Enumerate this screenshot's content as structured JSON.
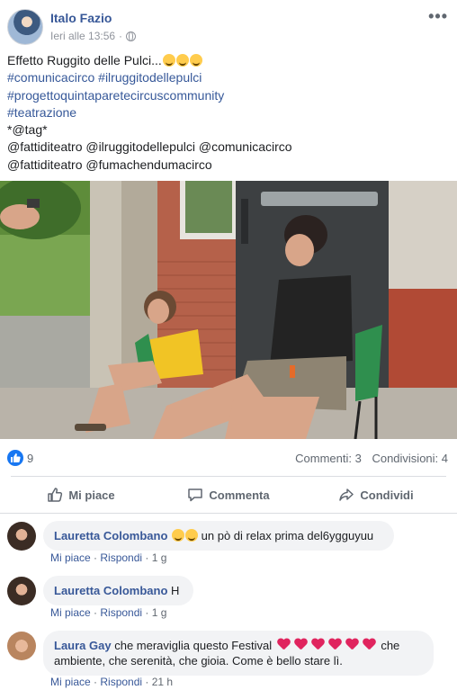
{
  "post": {
    "author": "Italo Fazio",
    "timestamp": "Ieri alle 13:56",
    "separator": "·",
    "more_label": "•••",
    "text_line1": "Effetto Ruggito delle Pulci...",
    "hashtag1": "#comunicacirco #ilruggitodellepulci",
    "hashtag2": "#progettoquintaparetecircuscommunity",
    "hashtag3": "#teatrazione",
    "tag_line": "*@tag*",
    "mentions1": "@fattiditeatro @ilruggitodellepulci @comunicacirco",
    "mentions2": "@fattiditeatro @fumachendumacirco"
  },
  "reactions": {
    "like_count": "9",
    "comments": "Commenti: 3",
    "shares": "Condivisioni: 4"
  },
  "actions": {
    "like": "Mi piace",
    "comment": "Commenta",
    "share": "Condividi"
  },
  "comments": [
    {
      "name": "Lauretta Colombano",
      "text": "un pò di relax prima del6ygguyuu",
      "like": "Mi piace",
      "reply": "Rispondi",
      "time": "1 g"
    },
    {
      "name": "Lauretta Colombano",
      "text": "H",
      "like": "Mi piace",
      "reply": "Rispondi",
      "time": "1 g"
    },
    {
      "name": "Laura Gay",
      "text_a": "che meraviglia questo Festival",
      "text_b": "che",
      "text_c": "ambiente, che serenità, che gioia. Come è bello stare lì.",
      "like": "Mi piace",
      "reply": "Rispondi",
      "time": "21 h"
    }
  ],
  "colors": {
    "link": "#385898",
    "like_blue": "#1877f2",
    "heart": "#e0245e"
  }
}
